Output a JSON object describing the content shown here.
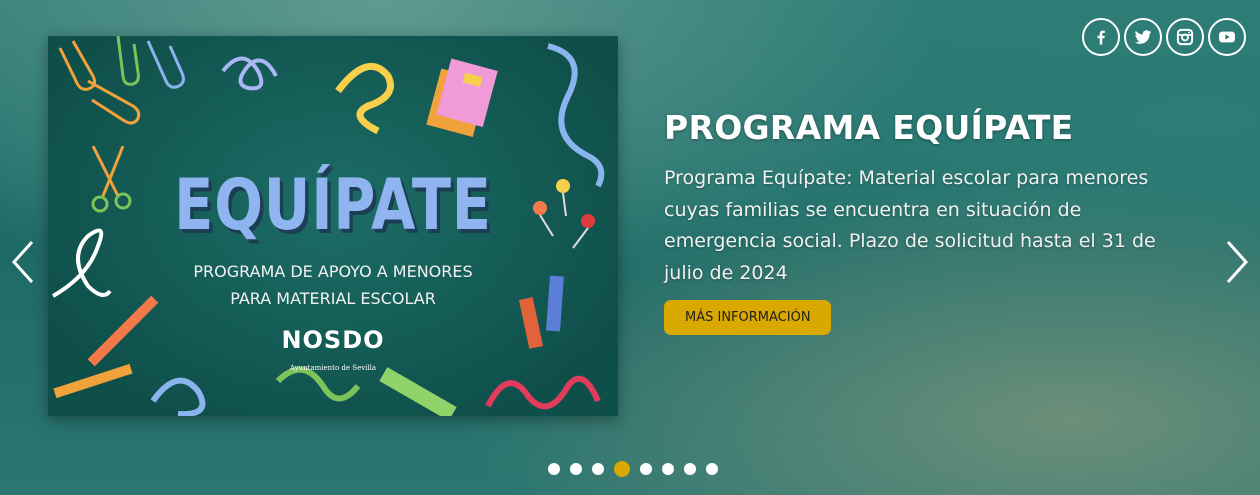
{
  "social": {
    "items": [
      {
        "name": "facebook",
        "icon": "facebook-icon"
      },
      {
        "name": "twitter",
        "icon": "twitter-icon"
      },
      {
        "name": "instagram",
        "icon": "instagram-icon"
      },
      {
        "name": "youtube",
        "icon": "youtube-icon"
      }
    ]
  },
  "slide": {
    "title": "PROGRAMA EQUÍPATE",
    "description": "Programa Equípate: Material escolar para menores cuyas familias se encuentra en situación de emergencia social. Plazo de solicitud hasta el 31 de julio de 2024",
    "button_label": "MÁS INFORMACIÓN",
    "poster": {
      "title": "EQUÍPATE",
      "subtitle_line1": "PROGRAMA DE APOYO A MENORES",
      "subtitle_line2": "PARA MATERIAL ESCOLAR",
      "logo": "NOSDO",
      "org": "Ayuntamiento de Sevilla"
    }
  },
  "pagination": {
    "total": 8,
    "active_index": 3
  },
  "colors": {
    "accent": "#d9a900",
    "background": "#2a7470"
  }
}
